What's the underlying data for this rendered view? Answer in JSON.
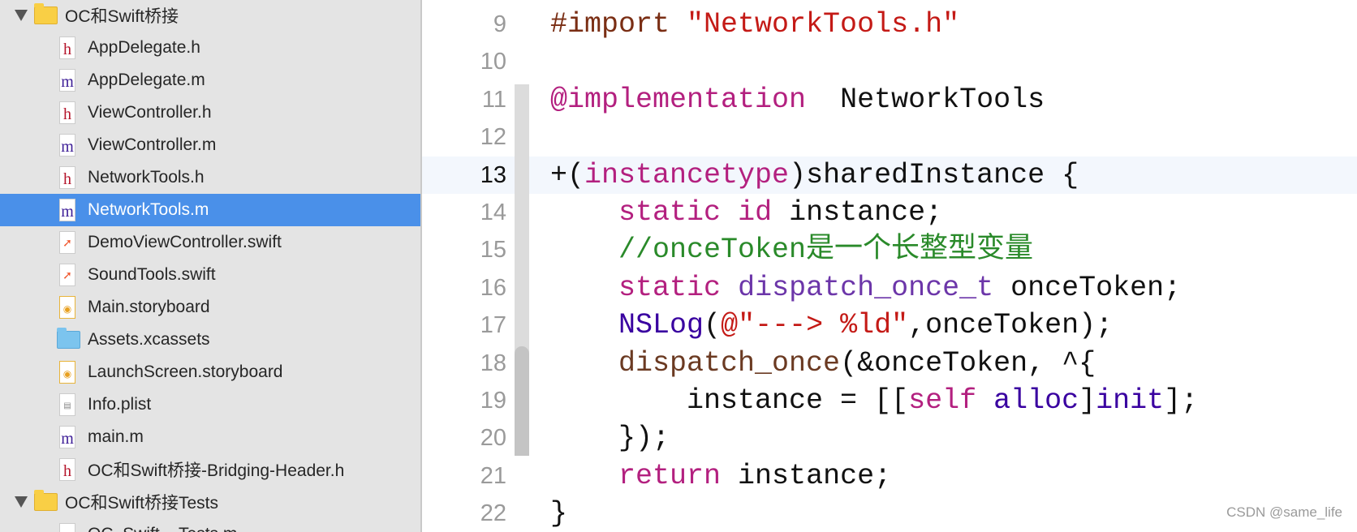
{
  "navigator": {
    "items": [
      {
        "type": "folder",
        "label": "OC和Swift桥接",
        "expanded": true
      },
      {
        "type": "h",
        "label": "AppDelegate.h"
      },
      {
        "type": "m",
        "label": "AppDelegate.m"
      },
      {
        "type": "h",
        "label": "ViewController.h"
      },
      {
        "type": "m",
        "label": "ViewController.m"
      },
      {
        "type": "h",
        "label": "NetworkTools.h"
      },
      {
        "type": "m",
        "label": "NetworkTools.m",
        "selected": true
      },
      {
        "type": "swift",
        "label": "DemoViewController.swift"
      },
      {
        "type": "swift",
        "label": "SoundTools.swift"
      },
      {
        "type": "storyboard",
        "label": "Main.storyboard"
      },
      {
        "type": "assets",
        "label": "Assets.xcassets"
      },
      {
        "type": "storyboard",
        "label": "LaunchScreen.storyboard"
      },
      {
        "type": "plist",
        "label": "Info.plist"
      },
      {
        "type": "m",
        "label": "main.m"
      },
      {
        "type": "h",
        "label": "OC和Swift桥接-Bridging-Header.h"
      },
      {
        "type": "folder",
        "label": "OC和Swift桥接Tests",
        "expanded": true
      },
      {
        "type": "m",
        "label": "OC_Swift__Tests.m"
      }
    ],
    "selection_color": "#4a90e9"
  },
  "editor": {
    "current_line": 13,
    "lines": [
      {
        "n": "9",
        "tokens": [
          [
            "pp",
            "#import "
          ],
          [
            "str",
            "\"NetworkTools.h\""
          ]
        ]
      },
      {
        "n": "10",
        "tokens": []
      },
      {
        "n": "11",
        "tokens": [
          [
            "kw",
            "@implementation"
          ],
          [
            "",
            "  NetworkTools"
          ]
        ]
      },
      {
        "n": "12",
        "tokens": []
      },
      {
        "n": "13",
        "tokens": [
          [
            "",
            "+("
          ],
          [
            "kw",
            "instancetype"
          ],
          [
            "",
            ")sharedInstance {"
          ]
        ]
      },
      {
        "n": "14",
        "tokens": [
          [
            "",
            "    "
          ],
          [
            "kw",
            "static"
          ],
          [
            "",
            " "
          ],
          [
            "kw",
            "id"
          ],
          [
            "",
            " instance;"
          ]
        ]
      },
      {
        "n": "15",
        "tokens": [
          [
            "",
            "    "
          ],
          [
            "cm",
            "//onceToken是一个长整型变量"
          ]
        ]
      },
      {
        "n": "16",
        "tokens": [
          [
            "",
            "    "
          ],
          [
            "kw",
            "static"
          ],
          [
            "",
            " "
          ],
          [
            "ty",
            "dispatch_once_t"
          ],
          [
            "",
            " onceToken;"
          ]
        ]
      },
      {
        "n": "17",
        "tokens": [
          [
            "",
            "    "
          ],
          [
            "fn",
            "NSLog"
          ],
          [
            "",
            "("
          ],
          [
            "str",
            "@\"---> %ld\""
          ],
          [
            "",
            ",onceToken);"
          ]
        ]
      },
      {
        "n": "18",
        "tokens": [
          [
            "",
            "    "
          ],
          [
            "br",
            "dispatch_once"
          ],
          [
            "",
            "(&onceToken, ^{"
          ]
        ]
      },
      {
        "n": "19",
        "tokens": [
          [
            "",
            "        instance = [["
          ],
          [
            "kw",
            "self"
          ],
          [
            "",
            " "
          ],
          [
            "fn",
            "alloc"
          ],
          [
            "",
            "]"
          ],
          [
            "fn",
            "init"
          ],
          [
            "",
            "];"
          ]
        ]
      },
      {
        "n": "20",
        "tokens": [
          [
            "",
            "    });"
          ]
        ]
      },
      {
        "n": "21",
        "tokens": [
          [
            "",
            "    "
          ],
          [
            "kw",
            "return"
          ],
          [
            "",
            " instance;"
          ]
        ]
      },
      {
        "n": "22",
        "tokens": [
          [
            "",
            "}"
          ]
        ]
      }
    ]
  },
  "watermark": "CSDN @same_life"
}
